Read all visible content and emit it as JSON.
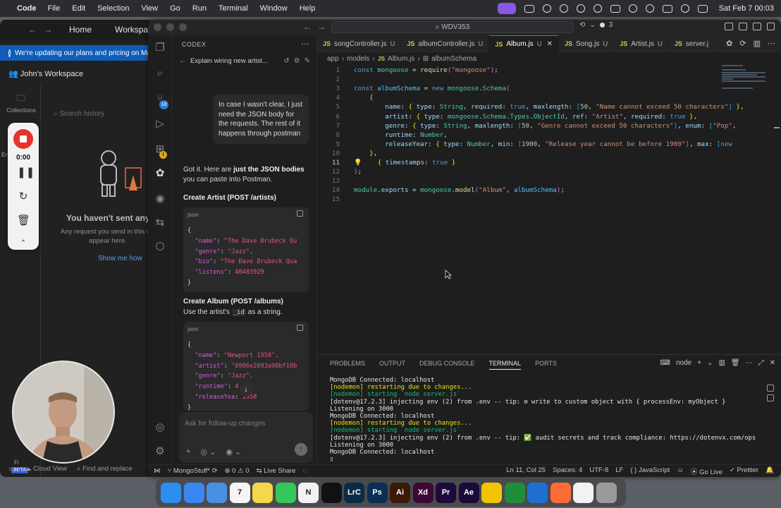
{
  "menubar": {
    "app_name": "Code",
    "menus": [
      "File",
      "Edit",
      "Selection",
      "View",
      "Go",
      "Run",
      "Terminal",
      "Window",
      "Help"
    ],
    "clock": "Sat Feb 7  00:03"
  },
  "postman": {
    "tab_home": "Home",
    "tab_workspaces": "Workspace",
    "banner": "We're updating our plans and pricing on Ma",
    "workspace": "John's Workspace",
    "sidebar_collections": "Collections",
    "sidebar_env": "En",
    "search_placeholder": "Search history",
    "empty_title": "You haven't sent any re",
    "empty_sub": "Any request you send in this wo appear here.",
    "show_me_how": "Show me how",
    "status_cloud": "Cloud View",
    "status_find": "Find and replace",
    "fi_label": "Fi",
    "beta_label": "BETA"
  },
  "recorder": {
    "time": "0:00"
  },
  "vscode": {
    "command_center": "WDV353",
    "copilot_count": "3",
    "codex": {
      "header": "CODEX",
      "thread_title": "Explain wiring new artist...",
      "user_message": "In case I wasn't clear, I just need the JSON body for the requests. The rest of it happens through postman",
      "reply_start": "Got it. Here are ",
      "reply_bold": "just the JSON bodies",
      "reply_end": " you can paste into Postman.",
      "heading_artist": "Create Artist (POST /artists)",
      "heading_album": "Create Album (POST /albums)",
      "album_note_a": "Use the artist's ",
      "album_note_code": "_id",
      "album_note_b": " as a string.",
      "code_lang": "json",
      "artist_json": [
        {
          "k": "\"name\"",
          "v": "\"The Dave Brubeck Qu",
          "t": "s"
        },
        {
          "k": "\"genre\"",
          "v": "\"Jazz\",",
          "t": "s"
        },
        {
          "k": "\"bio\"",
          "v": "\"The Dave Brubeck Qua",
          "t": "s"
        },
        {
          "k": "\"listens\"",
          "v": "40483929",
          "t": "n"
        }
      ],
      "album_json": [
        {
          "k": "\"name\"",
          "v": "\"Newport 1958\",",
          "t": "s"
        },
        {
          "k": "\"artist\"",
          "v": "\"6986e2693a98bf10b",
          "t": "s"
        },
        {
          "k": "\"genre\"",
          "v": "\"Jazz\",",
          "t": "s"
        },
        {
          "k": "\"runtime\"",
          "v": "4  1,",
          "t": "n"
        },
        {
          "k": "\"releaseYea",
          "v": "1958",
          "t": "n"
        }
      ],
      "followup_placeholder": "Ask for follow-up changes"
    },
    "tabs": [
      {
        "name": "songController.js",
        "status": "U",
        "active": false
      },
      {
        "name": "albumController.js",
        "status": "U",
        "active": false
      },
      {
        "name": "Album.js",
        "status": "U",
        "active": true
      },
      {
        "name": "Song.js",
        "status": "U",
        "active": false
      },
      {
        "name": "Artist.js",
        "status": "U",
        "active": false
      },
      {
        "name": "server.j",
        "status": "",
        "active": false
      }
    ],
    "breadcrumbs": [
      "app",
      "models",
      "Album.js",
      "albumSchema"
    ],
    "code_lines": [
      "const mongoose = require(\"mongoose\");",
      "",
      "const albumSchema = new mongoose.Schema(",
      "    {",
      "        name: { type: String, required: true, maxlength: [50, \"Name cannot exceed 50 characters\"] },",
      "        artist: { type: mongoose.Schema.Types.ObjectId, ref: \"Artist\", required: true },",
      "        genre: { type: String, maxlength: [50, \"Genre cannot exceed 50 characters\"], enum: [\"Pop\",",
      "        runtime: Number,",
      "        releaseYear: { type: Number, min: [1900, \"Release year cannot be before 1900\"], max: [new",
      "    },",
      "    { timestamps: true }",
      ");",
      "",
      "module.exports = mongoose.model(\"Album\", albumSchema);",
      ""
    ],
    "panel_tabs": [
      "PROBLEMS",
      "OUTPUT",
      "DEBUG CONSOLE",
      "TERMINAL",
      "PORTS"
    ],
    "panel_active": "TERMINAL",
    "terminal_shell": "node",
    "terminal_lines": [
      {
        "text": "MongoDB Connected: localhost",
        "c": ""
      },
      {
        "text": "[nodemon] restarting due to changes...",
        "c": "yel"
      },
      {
        "text": "[nodemon] starting `node server.js`",
        "c": "grn"
      },
      {
        "text": "[dotenv@17.2.3] injecting env (2) from .env -- tip: ⚙ write to custom object with { processEnv: myObject }",
        "c": ""
      },
      {
        "text": "Listening on 3000",
        "c": ""
      },
      {
        "text": "MongoDB Connected: localhost",
        "c": ""
      },
      {
        "text": "[nodemon] restarting due to changes...",
        "c": "yel"
      },
      {
        "text": "[nodemon] starting `node server.js`",
        "c": "grn"
      },
      {
        "text": "[dotenv@17.2.3] injecting env (2) from .env -- tip: ✅ audit secrets and track compliance: https://dotenvx.com/ops",
        "c": ""
      },
      {
        "text": "Listening on 3000",
        "c": ""
      },
      {
        "text": "MongoDB Connected: localhost",
        "c": ""
      },
      {
        "text": "▯",
        "c": ""
      }
    ],
    "status": {
      "branch": "MongoStuff*",
      "errors": "⊗ 0",
      "warnings": "⚠ 0",
      "live_share": "Live Share",
      "position": "Ln 11, Col 25",
      "spaces": "Spaces: 4",
      "encoding": "UTF-8",
      "eol": "LF",
      "language": "{ } JavaScript",
      "go_live": "Go Live",
      "prettier": "Prettier"
    }
  },
  "dock": [
    {
      "name": "finder",
      "color": "#2c8ef0",
      "label": ""
    },
    {
      "name": "safari",
      "color": "#3a87f2",
      "label": ""
    },
    {
      "name": "mail",
      "color": "#4a90e2",
      "label": ""
    },
    {
      "name": "calendar",
      "color": "#f5f5f5",
      "label": "7"
    },
    {
      "name": "notes",
      "color": "#f6d64a",
      "label": ""
    },
    {
      "name": "messages",
      "color": "#34c759",
      "label": ""
    },
    {
      "name": "notion",
      "color": "#f2f2f2",
      "label": "N"
    },
    {
      "name": "chatgpt",
      "color": "#111111",
      "label": ""
    },
    {
      "name": "lightroom",
      "color": "#0b2a46",
      "label": "LrC"
    },
    {
      "name": "photoshop",
      "color": "#0a2f52",
      "label": "Ps"
    },
    {
      "name": "illustrator",
      "color": "#3a1a06",
      "label": "Ai"
    },
    {
      "name": "xd",
      "color": "#3d0834",
      "label": "Xd"
    },
    {
      "name": "premiere",
      "color": "#1e0a3a",
      "label": "Pr"
    },
    {
      "name": "after-effects",
      "color": "#1a0a3a",
      "label": "Ae"
    },
    {
      "name": "tes",
      "color": "#f2c400",
      "label": ""
    },
    {
      "name": "numbers",
      "color": "#1f8e3a",
      "label": ""
    },
    {
      "name": "vscode",
      "color": "#1f6fd1",
      "label": ""
    },
    {
      "name": "postman",
      "color": "#ff6c37",
      "label": ""
    },
    {
      "name": "mongodb-compass",
      "color": "#f2f2f2",
      "label": ""
    },
    {
      "name": "trash",
      "color": "#9a9a9a",
      "label": ""
    }
  ]
}
